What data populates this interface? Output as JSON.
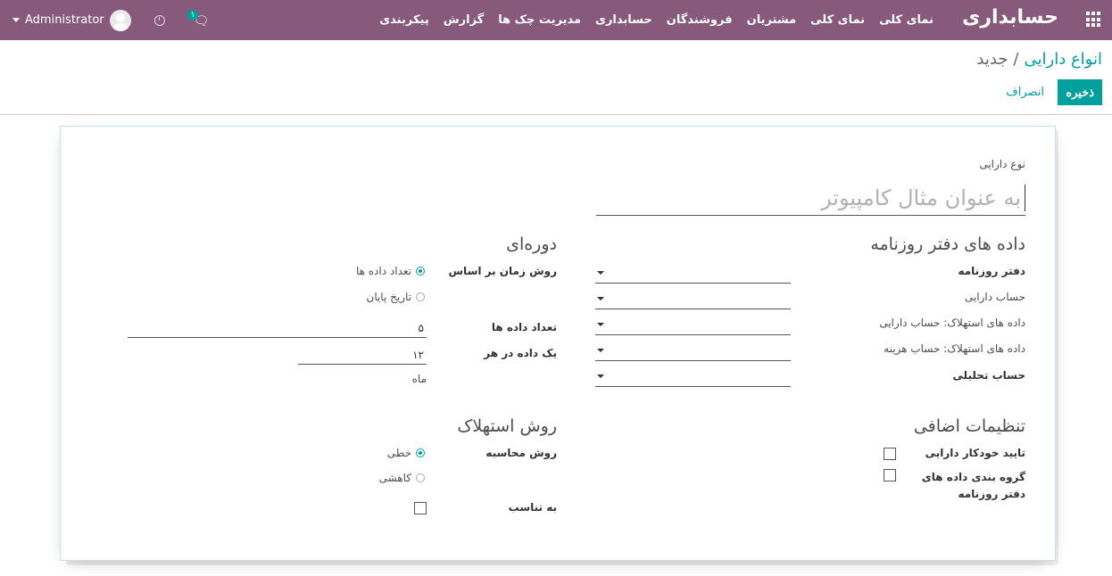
{
  "navbar": {
    "brand": "حسابداری",
    "menu": [
      "نمای کلی",
      "نمای کلی",
      "مشتریان",
      "فروشندگان",
      "حسابداری",
      "مدیریت چک ها",
      "گزارش",
      "پیکربندی"
    ],
    "user_name": "Administrator",
    "chat_badge": "۱"
  },
  "control_panel": {
    "breadcrumb_parent": "انواع دارایی",
    "breadcrumb_separator": "/",
    "breadcrumb_current": "جدید",
    "save_label": "ذخیره",
    "discard_label": "انصراف"
  },
  "form": {
    "name_label": "نوع دارایی",
    "name_placeholder": "به عنوان مثال کامپیوتر",
    "journal_section": {
      "title": "داده های دفتر روزنامه",
      "fields": [
        "دفتر روزنامه",
        "حساب دارایی",
        "داده های استهلاک: حساب دارایی",
        "داده های استهلاک: حساب هزینه",
        "حساب تحلیلی"
      ]
    },
    "periodicity_section": {
      "title": "دوره‌ای",
      "time_method_label": "روش زمان بر اساس",
      "time_method_options": [
        "تعداد داده ها",
        "تاریخ پایان"
      ],
      "time_method_selected": 0,
      "entries_count_label": "تعداد داده ها",
      "entries_count_value": "۵",
      "one_entry_every_label": "یک داده در هر",
      "one_entry_every_value": "۱۲",
      "unit": "ماه"
    },
    "additional_section": {
      "title": "تنظیمات اضافی",
      "auto_confirm_label": "تایید خودکار دارایی",
      "group_entries_label": "گروه بندی داده های دفتر روزنامه"
    },
    "depreciation_section": {
      "title": "روش استهلاک",
      "method_label": "روش محاسبه",
      "method_options": [
        "خطی",
        "کاهشی"
      ],
      "method_selected": 0,
      "prorata_label": "به تناسب"
    }
  }
}
